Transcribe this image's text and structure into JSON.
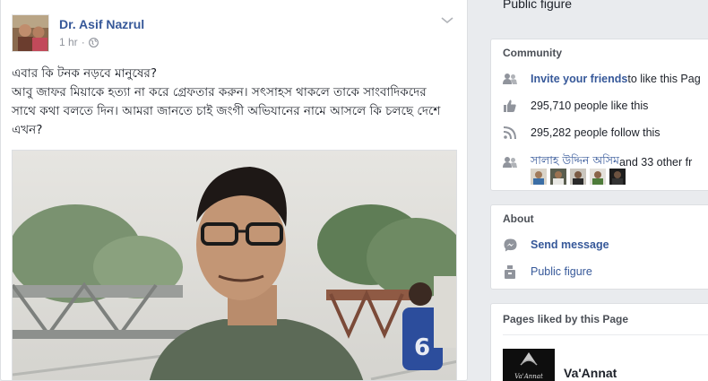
{
  "post": {
    "author": "Dr. Asif Nazrul",
    "time": "1 hr",
    "separator": "·",
    "lines": [
      "এবার কি টনক নড়বে মানুষের?",
      "আবু জাফর মিয়াকে হত্যা না করে গ্রেফতার করুন। সৎসাহস থাকলে তাকে সাংবাদিকদের",
      "সাথে কথা বলতে দিন। আমরা জানতে চাই জংগী অভিযানের নামে আসলে কি চলছে দেশে",
      "এখন?"
    ],
    "photo_jersey_number": "6"
  },
  "sidebar": {
    "top_label": "Public figure",
    "community": {
      "title": "Community",
      "invite_link": "Invite your friends",
      "invite_rest": " to like this Pag",
      "likes": "295,710 people like this",
      "follows": "295,282 people follow this",
      "friends_name": "সালাহ উদ্দিন অসিম",
      "friends_rest": " and 33 other fr"
    },
    "about": {
      "title": "About",
      "send_message": "Send message",
      "category": "Public figure"
    },
    "pages_liked": {
      "title": "Pages liked by this Page",
      "page_name": "Va'Annat",
      "logo_text": "Va'Annat"
    }
  },
  "colors": {
    "link": "#365899",
    "background": "#e9ebee",
    "icon": "#90949c"
  }
}
